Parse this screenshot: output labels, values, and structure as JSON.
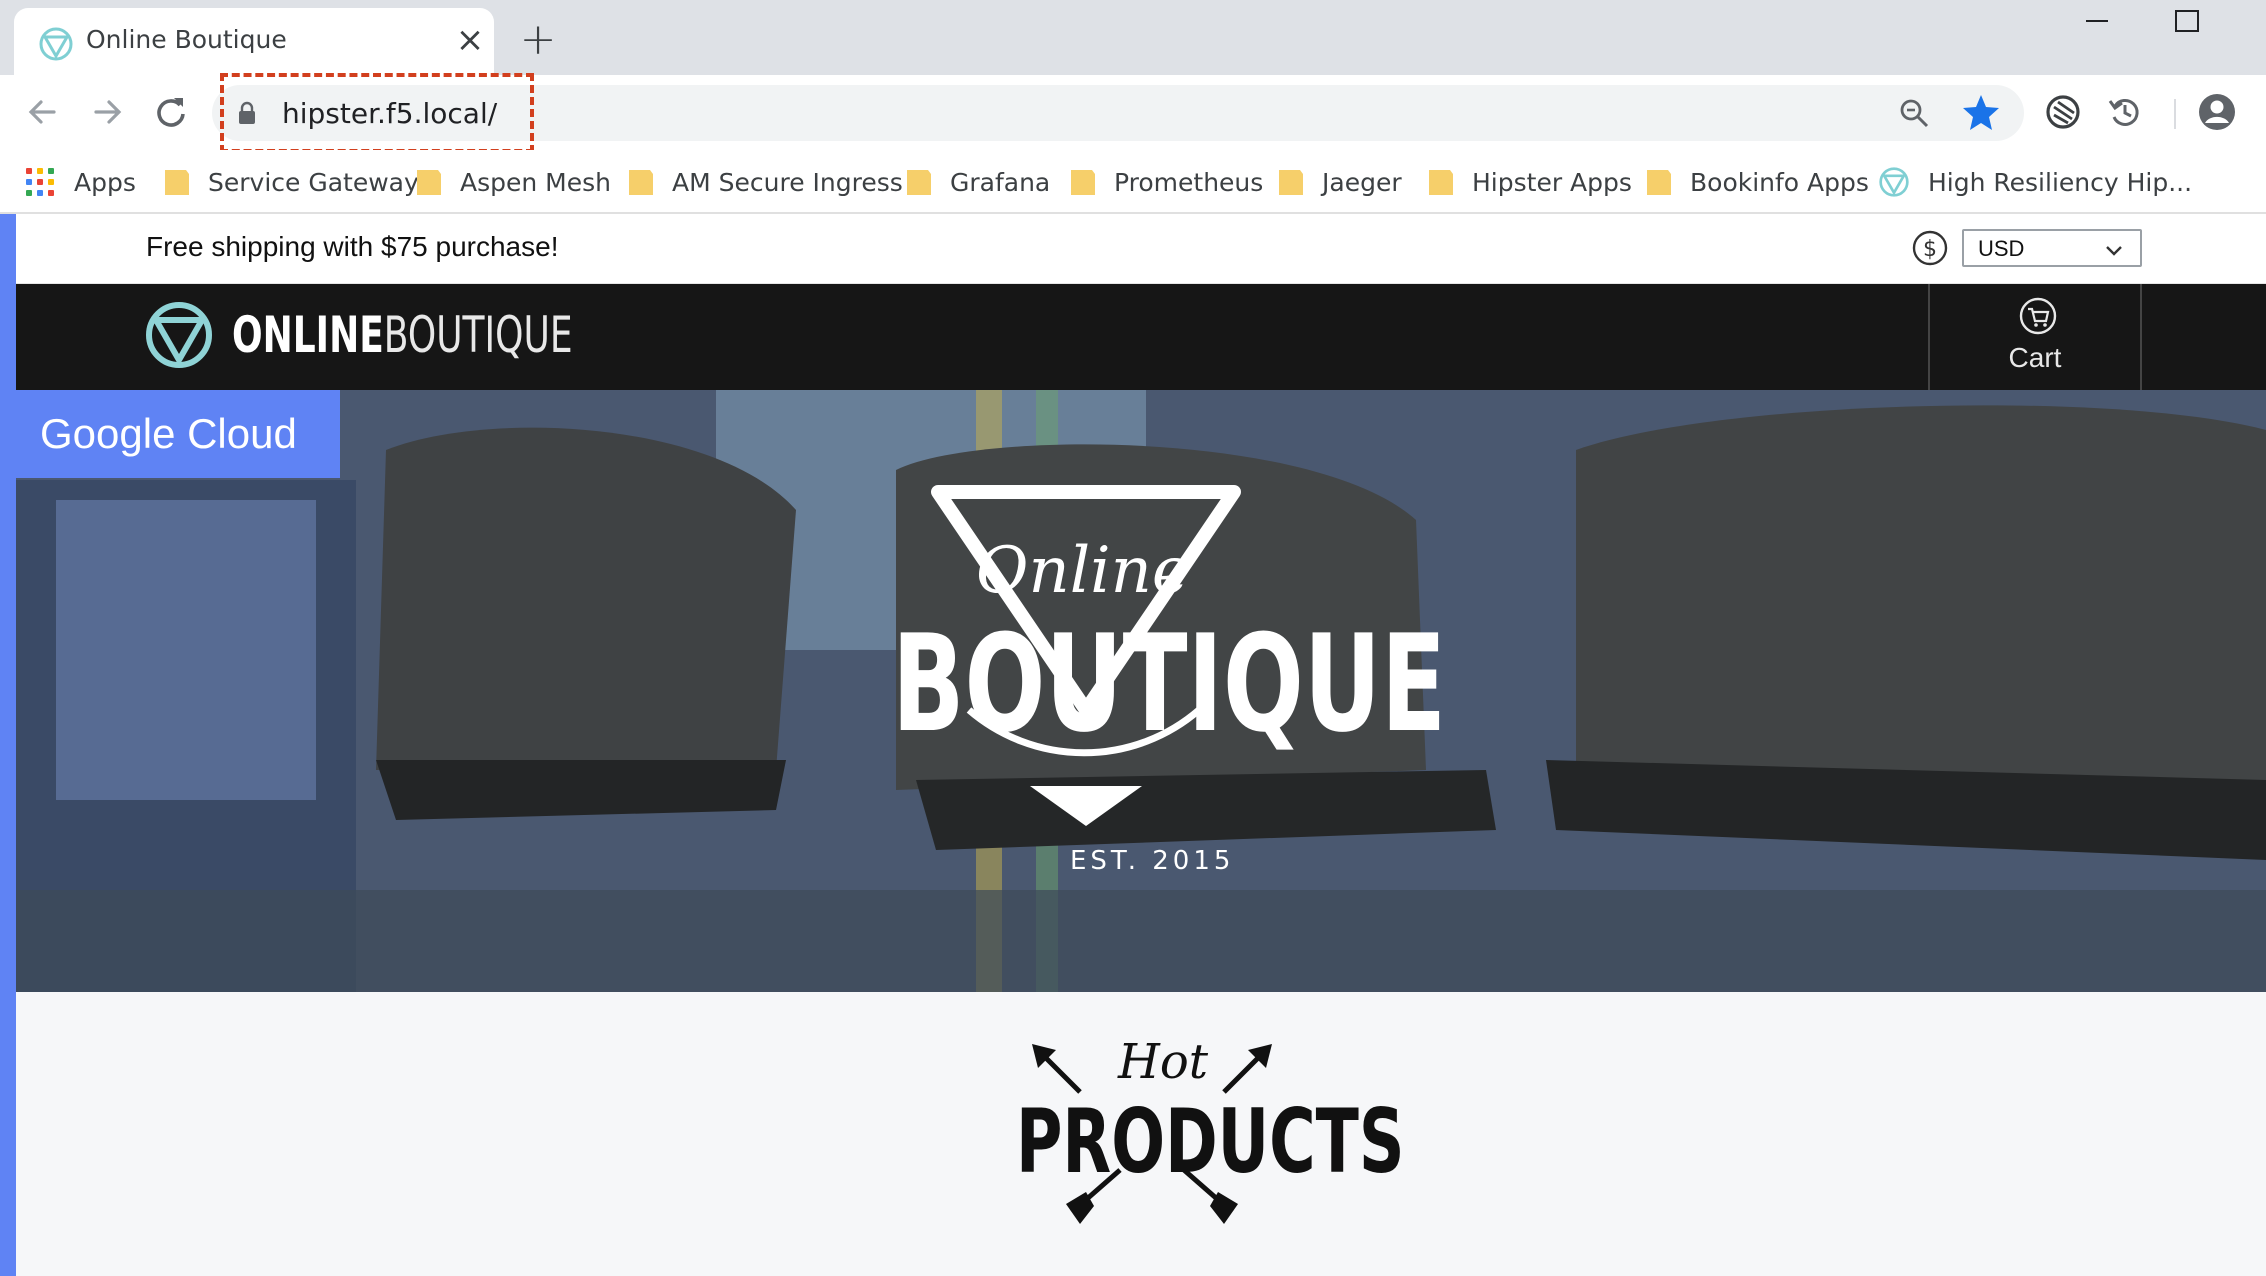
{
  "browser": {
    "tab": {
      "title": "Online Boutique",
      "close_glyph": "×"
    },
    "new_tab_glyph": "+",
    "address_bar": {
      "url": "hipster.f5.local/"
    },
    "annotation_color": "#d23f1e",
    "icons": [
      "back-icon",
      "forward-icon",
      "reload-icon",
      "lock-icon",
      "zoom-icon",
      "star-icon",
      "extension-icon",
      "history-icon",
      "profile-icon"
    ]
  },
  "bookmarks": {
    "apps_label": "Apps",
    "items": [
      {
        "label": "Service Gateway"
      },
      {
        "label": "Aspen Mesh"
      },
      {
        "label": "AM Secure Ingress"
      },
      {
        "label": "Grafana"
      },
      {
        "label": "Prometheus"
      },
      {
        "label": "Jaeger"
      },
      {
        "label": "Hipster Apps"
      },
      {
        "label": "Bookinfo Apps"
      },
      {
        "label": "High Resiliency Hip..."
      }
    ]
  },
  "shop": {
    "shipping_banner": "Free shipping with $75 purchase!",
    "currency": {
      "selected": "USD"
    },
    "brand": {
      "bold": "ONLINE",
      "light": "BOUTIQUE"
    },
    "cart_label": "Cart",
    "hero": {
      "badge": "Google Cloud",
      "logo_script": "Online",
      "logo_main": "BOUTIQUE",
      "logo_est": "EST. 2015"
    },
    "hot_products": {
      "script": "Hot",
      "main": "PRODUCTS"
    },
    "colors": {
      "accent": "#5f83f4",
      "navbar": "#161616",
      "logo_teal": "#8fd3d6"
    }
  }
}
